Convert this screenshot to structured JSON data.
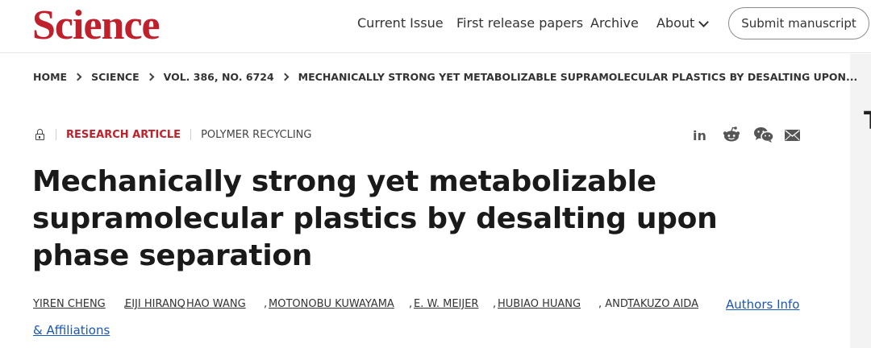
{
  "header": {
    "logo": "Science",
    "nav": [
      "Current Issue",
      "First release papers",
      "Archive",
      "About"
    ],
    "submit_label": "Submit manuscript"
  },
  "breadcrumb": [
    "HOME",
    "SCIENCE",
    "VOL. 386, NO. 6724",
    "MECHANICALLY STRONG YET METABOLIZABLE SUPRAMOLECULAR PLASTICS BY DESALTING UPON..."
  ],
  "article": {
    "type": "RESEARCH ARTICLE",
    "topic": "POLYMER RECYCLING",
    "title": "Mechanically strong yet metabolizable supramolecular plastics by desalting upon phase separation",
    "authors": [
      "YIREN CHENG",
      "EIJI HIRANO",
      "HAO WANG",
      "MOTONOBU KUWAYAMA",
      "E. W. MEIJER",
      "HUBIAO HUANG",
      "TAKUZO AIDA"
    ],
    "separators": [
      ",",
      ",",
      ",",
      ",",
      ",",
      ", AND"
    ],
    "authors_info_label": "Authors Info",
    "affiliations_label": "& Affiliations"
  },
  "share_icons": [
    "linkedin-icon",
    "reddit-icon",
    "wechat-icon",
    "email-icon"
  ],
  "right_glyph": "T",
  "colors": {
    "brand": "#c0202b",
    "link": "#1a56b8"
  }
}
